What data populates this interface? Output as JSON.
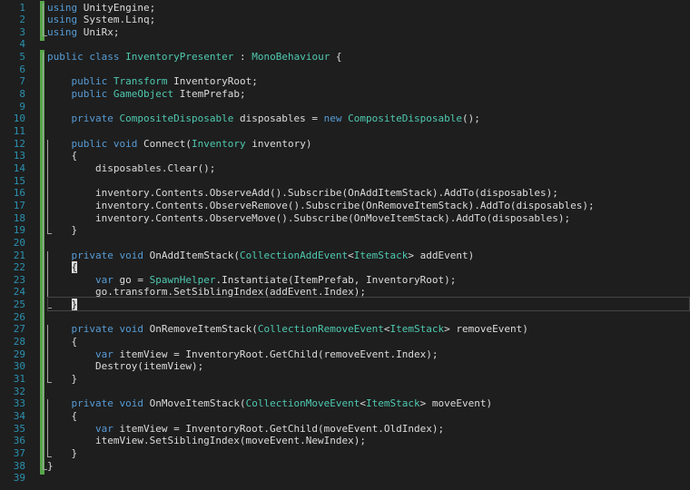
{
  "editor": {
    "language": "csharp",
    "colors": {
      "background": "#1e1e1e",
      "line_number": "#2b91af",
      "keyword": "#569cd6",
      "type": "#4ec9b0",
      "text": "#dcdcdc",
      "changed_bar": "#57a64a"
    },
    "lines": [
      [
        {
          "t": "using",
          "k": "kw"
        },
        {
          "t": " UnityEngine;",
          "k": "plain"
        }
      ],
      [
        {
          "t": "using",
          "k": "kw"
        },
        {
          "t": " System.Linq;",
          "k": "plain"
        }
      ],
      [
        {
          "t": "using",
          "k": "kw"
        },
        {
          "t": " UniRx;",
          "k": "plain"
        }
      ],
      [],
      [
        {
          "t": "public",
          "k": "kw"
        },
        {
          "t": " ",
          "k": "plain"
        },
        {
          "t": "class",
          "k": "kw"
        },
        {
          "t": " ",
          "k": "plain"
        },
        {
          "t": "InventoryPresenter",
          "k": "type"
        },
        {
          "t": " : ",
          "k": "plain"
        },
        {
          "t": "MonoBehaviour",
          "k": "type"
        },
        {
          "t": " {",
          "k": "plain"
        }
      ],
      [],
      [
        {
          "t": "    ",
          "k": "plain"
        },
        {
          "t": "public",
          "k": "kw"
        },
        {
          "t": " ",
          "k": "plain"
        },
        {
          "t": "Transform",
          "k": "type"
        },
        {
          "t": " InventoryRoot;",
          "k": "plain"
        }
      ],
      [
        {
          "t": "    ",
          "k": "plain"
        },
        {
          "t": "public",
          "k": "kw"
        },
        {
          "t": " ",
          "k": "plain"
        },
        {
          "t": "GameObject",
          "k": "type"
        },
        {
          "t": " ItemPrefab;",
          "k": "plain"
        }
      ],
      [],
      [
        {
          "t": "    ",
          "k": "plain"
        },
        {
          "t": "private",
          "k": "kw"
        },
        {
          "t": " ",
          "k": "plain"
        },
        {
          "t": "CompositeDisposable",
          "k": "type"
        },
        {
          "t": " disposables = ",
          "k": "plain"
        },
        {
          "t": "new",
          "k": "kw"
        },
        {
          "t": " ",
          "k": "plain"
        },
        {
          "t": "CompositeDisposable",
          "k": "type"
        },
        {
          "t": "();",
          "k": "plain"
        }
      ],
      [],
      [
        {
          "t": "    ",
          "k": "plain"
        },
        {
          "t": "public",
          "k": "kw"
        },
        {
          "t": " ",
          "k": "plain"
        },
        {
          "t": "void",
          "k": "kw"
        },
        {
          "t": " Connect(",
          "k": "plain"
        },
        {
          "t": "Inventory",
          "k": "type"
        },
        {
          "t": " inventory)",
          "k": "plain"
        }
      ],
      [
        {
          "t": "    {",
          "k": "plain"
        }
      ],
      [
        {
          "t": "        disposables.Clear();",
          "k": "plain"
        }
      ],
      [],
      [
        {
          "t": "        inventory.Contents.ObserveAdd().Subscribe(OnAddItemStack).AddTo(disposables);",
          "k": "plain"
        }
      ],
      [
        {
          "t": "        inventory.Contents.ObserveRemove().Subscribe(OnRemoveItemStack).AddTo(disposables);",
          "k": "plain"
        }
      ],
      [
        {
          "t": "        inventory.Contents.ObserveMove().Subscribe(OnMoveItemStack).AddTo(disposables);",
          "k": "plain"
        }
      ],
      [
        {
          "t": "    }",
          "k": "plain"
        }
      ],
      [],
      [
        {
          "t": "    ",
          "k": "plain"
        },
        {
          "t": "private",
          "k": "kw"
        },
        {
          "t": " ",
          "k": "plain"
        },
        {
          "t": "void",
          "k": "kw"
        },
        {
          "t": " OnAddItemStack(",
          "k": "plain"
        },
        {
          "t": "CollectionAddEvent",
          "k": "type"
        },
        {
          "t": "<",
          "k": "plain"
        },
        {
          "t": "ItemStack",
          "k": "type"
        },
        {
          "t": "> addEvent)",
          "k": "plain"
        }
      ],
      [
        {
          "t": "    ",
          "k": "plain"
        },
        {
          "t": "{",
          "k": "caret"
        }
      ],
      [
        {
          "t": "        ",
          "k": "plain"
        },
        {
          "t": "var",
          "k": "kw"
        },
        {
          "t": " go = ",
          "k": "plain"
        },
        {
          "t": "SpawnHelper",
          "k": "type"
        },
        {
          "t": ".Instantiate(ItemPrefab, InventoryRoot);",
          "k": "plain"
        }
      ],
      [
        {
          "t": "        go.transform.SetSiblingIndex(addEvent.Index);",
          "k": "plain"
        }
      ],
      [
        {
          "t": "    ",
          "k": "plain"
        },
        {
          "t": "}",
          "k": "caret"
        }
      ],
      [],
      [
        {
          "t": "    ",
          "k": "plain"
        },
        {
          "t": "private",
          "k": "kw"
        },
        {
          "t": " ",
          "k": "plain"
        },
        {
          "t": "void",
          "k": "kw"
        },
        {
          "t": " OnRemoveItemStack(",
          "k": "plain"
        },
        {
          "t": "CollectionRemoveEvent",
          "k": "type"
        },
        {
          "t": "<",
          "k": "plain"
        },
        {
          "t": "ItemStack",
          "k": "type"
        },
        {
          "t": "> removeEvent)",
          "k": "plain"
        }
      ],
      [
        {
          "t": "    {",
          "k": "plain"
        }
      ],
      [
        {
          "t": "        ",
          "k": "plain"
        },
        {
          "t": "var",
          "k": "kw"
        },
        {
          "t": " itemView = InventoryRoot.GetChild(removeEvent.Index);",
          "k": "plain"
        }
      ],
      [
        {
          "t": "        Destroy(itemView);",
          "k": "plain"
        }
      ],
      [
        {
          "t": "    }",
          "k": "plain"
        }
      ],
      [],
      [
        {
          "t": "    ",
          "k": "plain"
        },
        {
          "t": "private",
          "k": "kw"
        },
        {
          "t": " ",
          "k": "plain"
        },
        {
          "t": "void",
          "k": "kw"
        },
        {
          "t": " OnMoveItemStack(",
          "k": "plain"
        },
        {
          "t": "CollectionMoveEvent",
          "k": "type"
        },
        {
          "t": "<",
          "k": "plain"
        },
        {
          "t": "ItemStack",
          "k": "type"
        },
        {
          "t": "> moveEvent)",
          "k": "plain"
        }
      ],
      [
        {
          "t": "    {",
          "k": "plain"
        }
      ],
      [
        {
          "t": "        ",
          "k": "plain"
        },
        {
          "t": "var",
          "k": "kw"
        },
        {
          "t": " itemView = InventoryRoot.GetChild(moveEvent.OldIndex);",
          "k": "plain"
        }
      ],
      [
        {
          "t": "        itemView.SetSiblingIndex(moveEvent.NewIndex);",
          "k": "plain"
        }
      ],
      [
        {
          "t": "    }",
          "k": "plain"
        }
      ],
      [
        {
          "t": "}",
          "k": "plain"
        }
      ],
      []
    ],
    "line_numbers": [
      "1",
      "2",
      "3",
      "4",
      "5",
      "6",
      "7",
      "8",
      "9",
      "10",
      "11",
      "12",
      "13",
      "14",
      "15",
      "16",
      "17",
      "18",
      "19",
      "20",
      "21",
      "22",
      "23",
      "24",
      "25",
      "26",
      "27",
      "28",
      "29",
      "30",
      "31",
      "32",
      "33",
      "34",
      "35",
      "36",
      "37",
      "38",
      "39"
    ],
    "changed_lines": [
      1,
      2,
      3,
      5,
      6,
      7,
      8,
      9,
      10,
      11,
      12,
      13,
      14,
      15,
      16,
      17,
      18,
      19,
      20,
      21,
      22,
      23,
      24,
      25,
      26,
      27,
      28,
      29,
      30,
      31,
      32,
      33,
      34,
      35,
      36,
      37,
      38
    ]
  }
}
